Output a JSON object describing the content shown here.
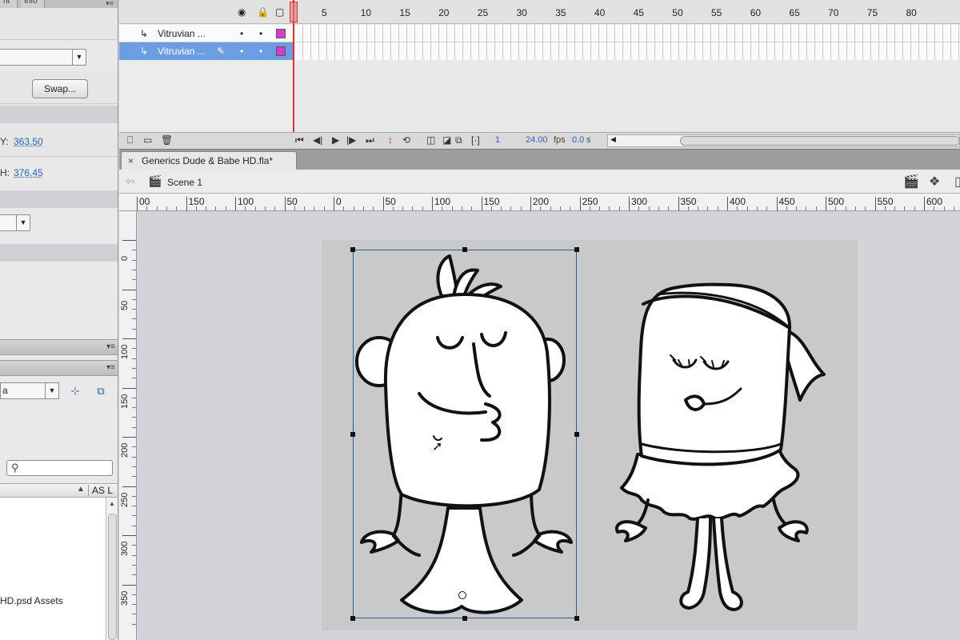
{
  "left_panel": {
    "tabs": [
      "ht",
      "Info"
    ],
    "swap_label": "Swap...",
    "y_label": "Y:",
    "y_value": "363.50",
    "h_label": "H:",
    "h_value": "376.45",
    "library_select": "a",
    "library_item": "HD.psd Assets",
    "col_header": "AS L",
    "menu_glyph": "▾≡"
  },
  "timeline": {
    "frame_numbers": [
      "5",
      "10",
      "15",
      "20",
      "25",
      "30",
      "35",
      "40",
      "45",
      "50",
      "55",
      "60",
      "65",
      "70",
      "75",
      "80"
    ],
    "layers": [
      {
        "name": "Vitruvian ..."
      },
      {
        "name": "Vitruvian ..."
      }
    ],
    "current_frame": "1",
    "fps": "24.00",
    "fps_unit": "fps",
    "time": "0.0",
    "time_unit": "s"
  },
  "document": {
    "tab_title": "Generics Dude & Babe HD.fla*",
    "scene": "Scene 1"
  },
  "ruler_top": {
    "labels": [
      "00",
      "150",
      "100",
      "50",
      "0",
      "50",
      "100",
      "150",
      "200",
      "250",
      "300",
      "350",
      "400",
      "450",
      "500",
      "550",
      "600"
    ]
  },
  "ruler_left": {
    "labels": [
      "0",
      "50",
      "100",
      "150",
      "200",
      "250",
      "300",
      "350"
    ]
  },
  "colors": {
    "layer_color": "#d93bd2",
    "selected_layer": "#6a9ee0",
    "playhead": "#d93333",
    "selection": "#2c5d9b"
  }
}
